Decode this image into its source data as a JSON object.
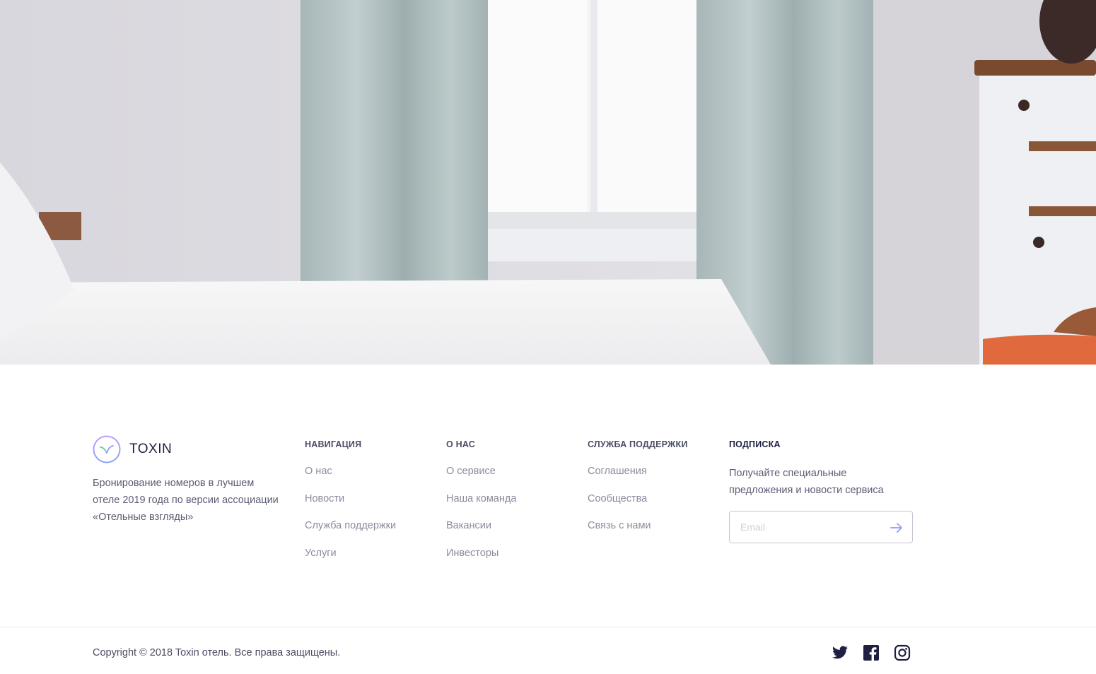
{
  "hero": {
    "image_alt": ""
  },
  "brand": {
    "name": "TOXIN",
    "description": "Бронирование номеров в лучшем отеле 2019 года по версии ассоциации «Отельные взгляды»"
  },
  "columns": [
    {
      "title": "навигация",
      "links": [
        "О нас",
        "Новости",
        "Служба поддержки",
        "Услуги"
      ]
    },
    {
      "title": "о нас",
      "links": [
        "О сервисе",
        "Наша команда",
        "Вакансии",
        "Инвесторы"
      ]
    },
    {
      "title": "служба поддержки",
      "links": [
        "Соглашения",
        "Сообщества",
        "Связь с нами"
      ]
    }
  ],
  "subscribe": {
    "title": "подписка",
    "text": "Получайте специальные предложения и новости сервиса",
    "email_placeholder": "Email",
    "submit_icon": "arrow-right-icon"
  },
  "bottom": {
    "copyright": "Copyright © 2018 Toxin отель. Все права защищены.",
    "social_icons": [
      "twitter-icon",
      "facebook-icon",
      "instagram-icon"
    ]
  },
  "colors": {
    "accent": "#bc9cff",
    "accent2": "#8ba4f9",
    "accent_green": "#6fcf97",
    "dark": "#1f2041"
  }
}
